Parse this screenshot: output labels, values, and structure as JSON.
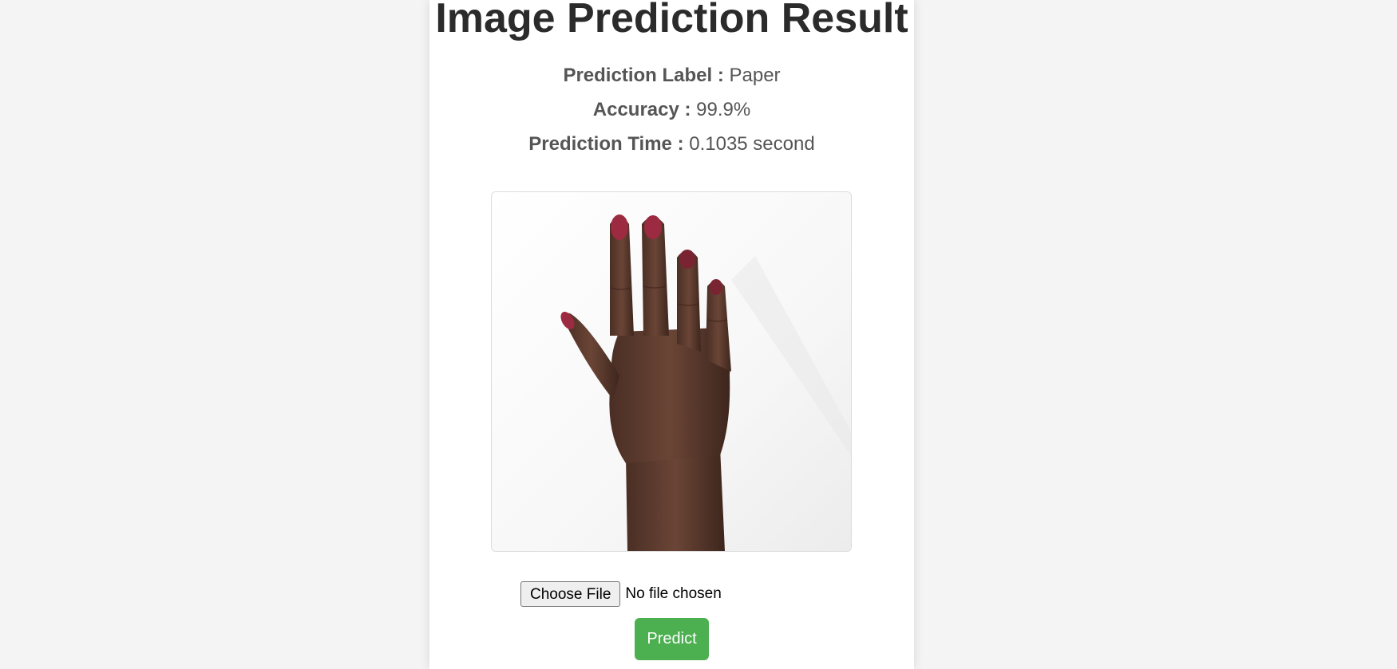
{
  "page": {
    "title": "Image Prediction Result"
  },
  "result": {
    "label_caption": "Prediction Label :",
    "label_value": "Paper",
    "accuracy_caption": "Accuracy :",
    "accuracy_value": "99.9%",
    "time_caption": "Prediction Time :",
    "time_value": "0.1035 second"
  },
  "image": {
    "subject": "open hand gesture (paper)"
  },
  "upload": {
    "choose_label": "Choose File",
    "status": "No file chosen"
  },
  "actions": {
    "predict_label": "Predict"
  },
  "colors": {
    "background": "#f4f4f4",
    "card": "#ffffff",
    "title": "#2b2b2b",
    "info_text": "#555555",
    "predict_button": "#4caf50",
    "skin": "#5a3a2e",
    "nail": "#9c2a40"
  }
}
